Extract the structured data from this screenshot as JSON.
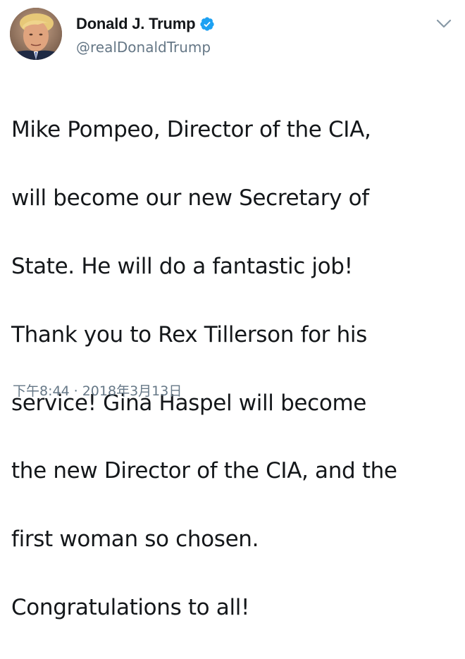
{
  "tweet": {
    "author": {
      "display_name": "Donald J. Trump",
      "handle": "@realDonaldTrump",
      "verified": true,
      "avatar_icon": "profile-photo"
    },
    "menu_icon": "chevron-down-icon",
    "text_lines": [
      "Mike Pompeo, Director of the CIA,",
      "will become our new Secretary of",
      "State. He will do a fantastic job!",
      "Thank you to Rex Tillerson for his",
      "service! Gina Haspel will become",
      "the new Director of the CIA, and the",
      "first woman so chosen.",
      "Congratulations to all!"
    ],
    "time": "下午8:44",
    "separator": "·",
    "date": "2018年3月13日"
  },
  "colors": {
    "verified_blue": "#1da1f2",
    "secondary_text": "#657786",
    "primary_text": "#14171a"
  }
}
